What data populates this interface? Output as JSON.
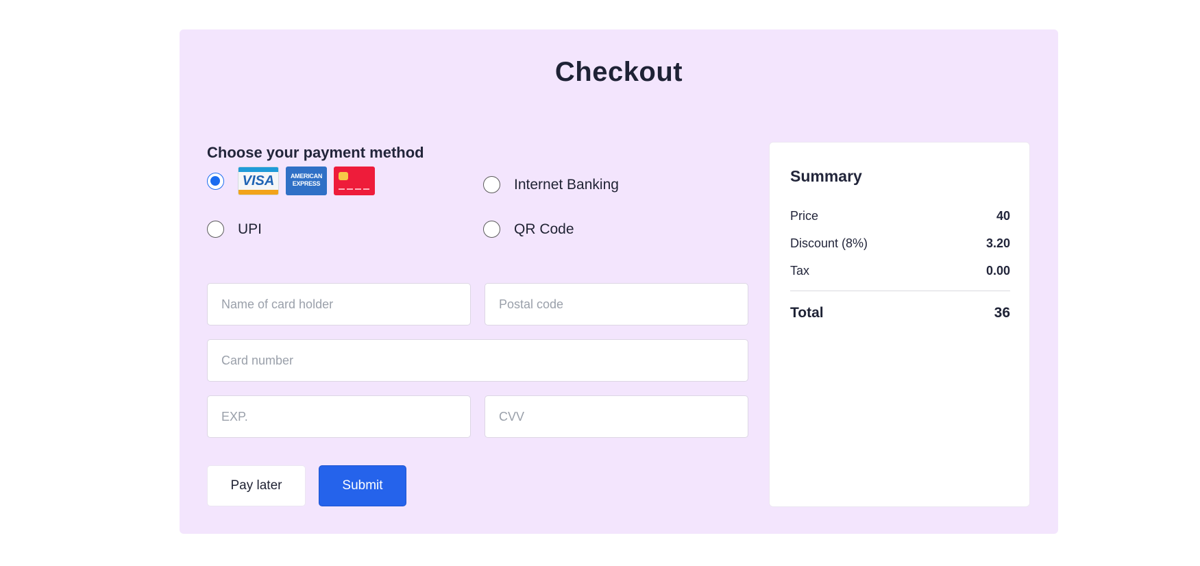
{
  "checkout": {
    "title": "Checkout",
    "payment_heading": "Choose your payment method",
    "methods": [
      {
        "id": "card",
        "label": "",
        "selected": true,
        "icons": [
          "visa-card-icon",
          "amex-card-icon",
          "generic-card-icon"
        ]
      },
      {
        "id": "internet-banking",
        "label": "Internet Banking",
        "selected": false
      },
      {
        "id": "upi",
        "label": "UPI",
        "selected": false
      },
      {
        "id": "qr-code",
        "label": "QR Code",
        "selected": false
      }
    ],
    "card_brands": {
      "visa": "VISA",
      "amex_line1": "AMERICAN",
      "amex_line2": "EXPRESS"
    },
    "fields": {
      "card_holder": {
        "value": "",
        "placeholder": "Name of card holder"
      },
      "postal_code": {
        "value": "",
        "placeholder": "Postal code"
      },
      "card_number": {
        "value": "",
        "placeholder": "Card number"
      },
      "exp": {
        "value": "",
        "placeholder": "EXP."
      },
      "cvv": {
        "value": "",
        "placeholder": "CVV"
      }
    },
    "buttons": {
      "pay_later": "Pay later",
      "submit": "Submit"
    }
  },
  "summary": {
    "title": "Summary",
    "rows": [
      {
        "label": "Price",
        "value": "40"
      },
      {
        "label": "Discount (8%)",
        "value": "3.20"
      },
      {
        "label": "Tax",
        "value": "0.00"
      }
    ],
    "total_label": "Total",
    "total_value": "36"
  },
  "colors": {
    "panel_bg": "#f3e5fd",
    "accent": "#2563eb",
    "radio_selected": "#1a6cf0"
  }
}
